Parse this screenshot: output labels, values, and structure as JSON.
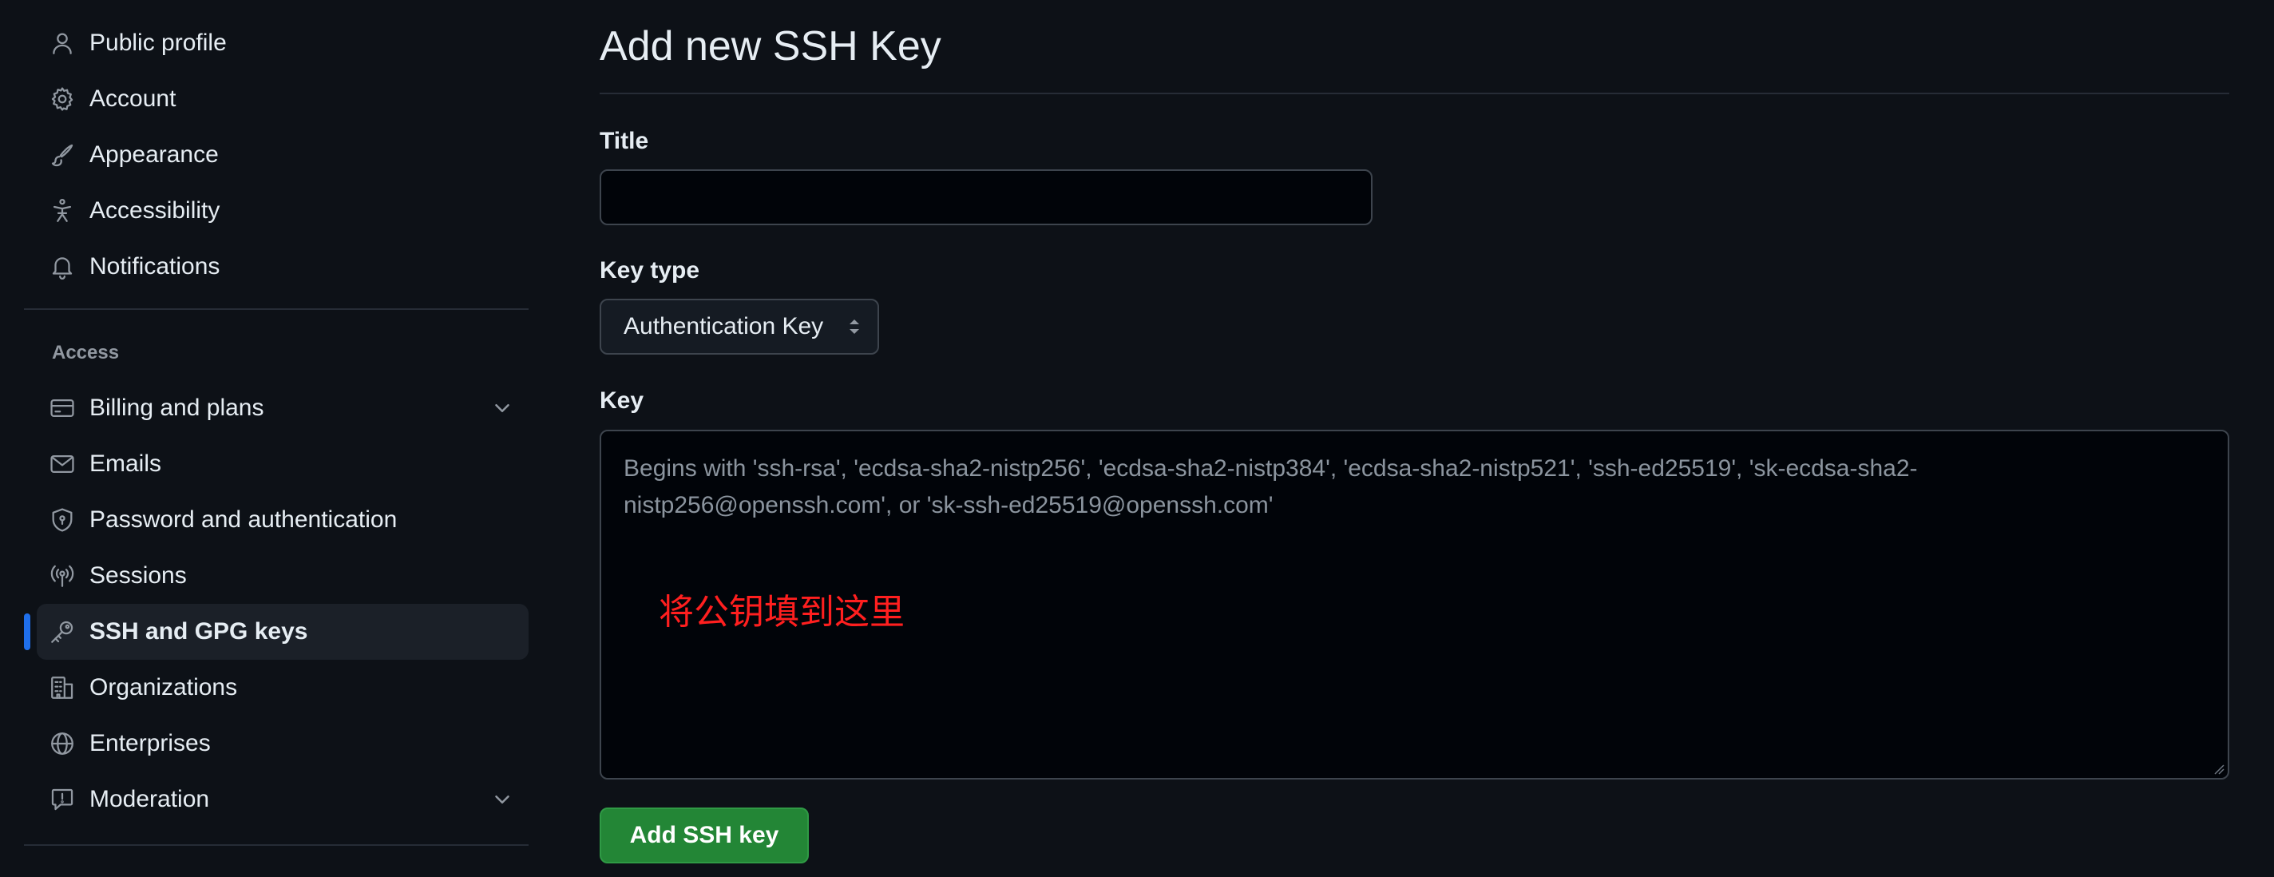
{
  "sidebar": {
    "group_primary": [
      {
        "label": "Public profile",
        "icon": "person-icon"
      },
      {
        "label": "Account",
        "icon": "gear-icon"
      },
      {
        "label": "Appearance",
        "icon": "paintbrush-icon"
      },
      {
        "label": "Accessibility",
        "icon": "accessibility-icon"
      },
      {
        "label": "Notifications",
        "icon": "bell-icon"
      }
    ],
    "section_title": "Access",
    "group_access": [
      {
        "label": "Billing and plans",
        "icon": "credit-card-icon",
        "expandable": true
      },
      {
        "label": "Emails",
        "icon": "mail-icon"
      },
      {
        "label": "Password and authentication",
        "icon": "shield-lock-icon"
      },
      {
        "label": "Sessions",
        "icon": "broadcast-icon"
      },
      {
        "label": "SSH and GPG keys",
        "icon": "key-icon",
        "active": true
      },
      {
        "label": "Organizations",
        "icon": "organization-icon"
      },
      {
        "label": "Enterprises",
        "icon": "globe-icon"
      },
      {
        "label": "Moderation",
        "icon": "report-icon",
        "expandable": true
      }
    ]
  },
  "main": {
    "title": "Add new SSH Key",
    "title_field": {
      "label": "Title",
      "value": ""
    },
    "key_type": {
      "label": "Key type",
      "selected": "Authentication Key"
    },
    "key_field": {
      "label": "Key",
      "placeholder": "Begins with 'ssh-rsa', 'ecdsa-sha2-nistp256', 'ecdsa-sha2-nistp384', 'ecdsa-sha2-nistp521', 'ssh-ed25519', 'sk-ecdsa-sha2-nistp256@openssh.com', or 'sk-ssh-ed25519@openssh.com'",
      "annotation": "将公钥填到这里"
    },
    "submit_label": "Add SSH key"
  },
  "colors": {
    "background": "#0d1117",
    "accent": "#1f6feb",
    "button": "#238636",
    "annotation": "#ff1f1f"
  }
}
